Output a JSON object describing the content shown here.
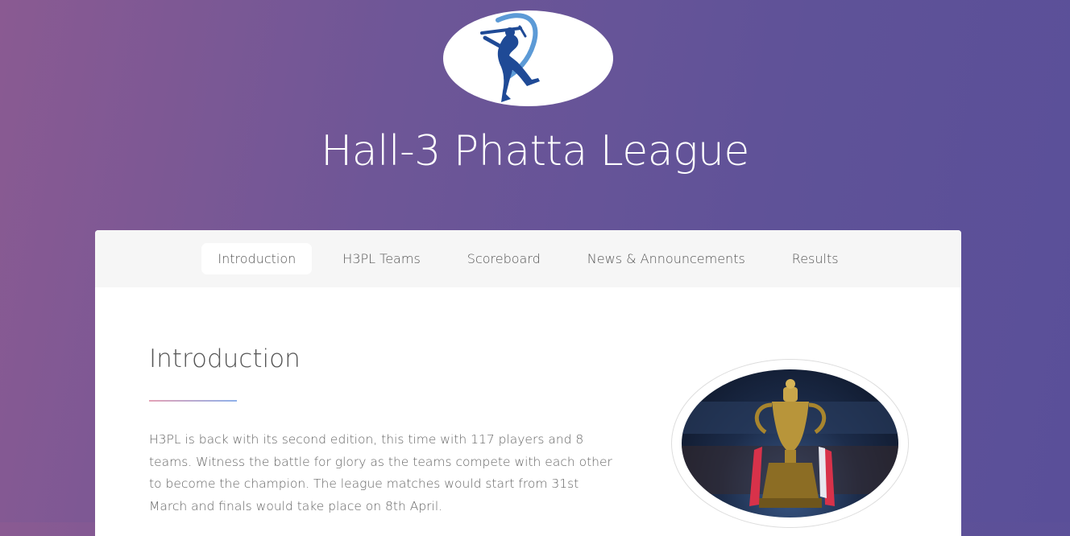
{
  "site": {
    "title": "Hall-3 Phatta League"
  },
  "nav": {
    "items": [
      {
        "label": "Introduction",
        "active": true
      },
      {
        "label": "H3PL Teams",
        "active": false
      },
      {
        "label": "Scoreboard",
        "active": false
      },
      {
        "label": "News & Announcements",
        "active": false
      },
      {
        "label": "Results",
        "active": false
      }
    ]
  },
  "intro": {
    "heading": "Introduction",
    "paragraph": "H3PL is back with its second edition, this time with 117 players and 8 teams. Witness the battle for glory as the teams compete with each other to become the champion. The league matches would start from 31st March and finals would take place on 8th April."
  },
  "icons": {
    "logo": "cricket-batsman-logo",
    "trophy": "trophy-image"
  },
  "colors": {
    "logo_blue": "#1f4a96",
    "divider_start": "#e4a2b6",
    "divider_end": "#8fb1ea"
  }
}
